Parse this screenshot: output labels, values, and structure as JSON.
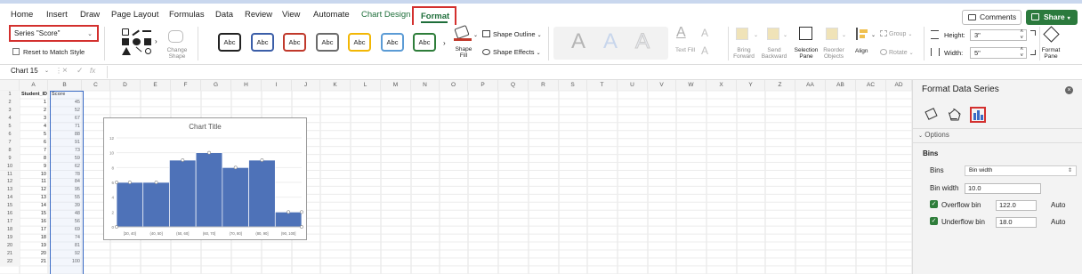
{
  "menu": {
    "tabs": [
      "Home",
      "Insert",
      "Draw",
      "Page Layout",
      "Formulas",
      "Data",
      "Review",
      "View",
      "Automate",
      "Chart Design"
    ],
    "active_tab": "Format",
    "comments": "Comments",
    "share": "Share"
  },
  "ribbon": {
    "series_select": "Series \"Score\"",
    "reset_label": "Reset to Match Style",
    "change_shape": [
      "Change",
      "Shape"
    ],
    "style_label": "Abc",
    "style_colors": [
      "#222222",
      "#3b5ea8",
      "#c0392b",
      "#6b6b6b",
      "#f2b705",
      "#5b9bd5",
      "#2e7d3a"
    ],
    "shape_fill": [
      "Shape",
      "Fill"
    ],
    "shape_outline": "Shape Outline",
    "shape_effects": "Shape Effects",
    "text_fill": "Text Fill",
    "bring_forward": [
      "Bring",
      "Forward"
    ],
    "send_backward": [
      "Send",
      "Backward"
    ],
    "selection_pane": [
      "Selection",
      "Pane"
    ],
    "reorder_objects": [
      "Reorder",
      "Objects"
    ],
    "align": "Align",
    "group": "Group",
    "rotate": "Rotate",
    "height_label": "Height:",
    "height_value": "3\"",
    "width_label": "Width:",
    "width_value": "5\"",
    "format_pane": [
      "Format",
      "Pane"
    ]
  },
  "formula_bar": {
    "name_box": "Chart 15",
    "fx": "fx"
  },
  "sheet": {
    "columns": [
      "A",
      "B",
      "C",
      "D",
      "E",
      "F",
      "G",
      "H",
      "I",
      "J",
      "K",
      "L",
      "M",
      "N",
      "O",
      "P",
      "Q",
      "R",
      "S",
      "T",
      "U",
      "V",
      "W",
      "X",
      "Y",
      "Z",
      "AA",
      "AB",
      "AC",
      "AD"
    ],
    "header_a": "Student_ID",
    "header_b": "Score",
    "rows": [
      [
        1,
        45
      ],
      [
        2,
        52
      ],
      [
        3,
        67
      ],
      [
        4,
        71
      ],
      [
        5,
        88
      ],
      [
        6,
        91
      ],
      [
        7,
        73
      ],
      [
        8,
        59
      ],
      [
        9,
        62
      ],
      [
        10,
        78
      ],
      [
        11,
        84
      ],
      [
        12,
        95
      ],
      [
        13,
        55
      ],
      [
        14,
        39
      ],
      [
        15,
        48
      ],
      [
        16,
        56
      ],
      [
        17,
        69
      ],
      [
        18,
        74
      ],
      [
        19,
        81
      ],
      [
        20,
        92
      ],
      [
        21,
        100
      ]
    ]
  },
  "chart": {
    "title": "Chart Title"
  },
  "chart_data": {
    "type": "bar",
    "title": "Chart Title",
    "categories": [
      "[30, 40]",
      "(40, 50]",
      "(50, 60]",
      "(60, 70]",
      "(70, 80]",
      "(80, 90]",
      "(90, 100]"
    ],
    "values": [
      6,
      6,
      9,
      10,
      8,
      9,
      2
    ],
    "ylim": [
      0,
      12
    ],
    "yticks": [
      0,
      2,
      4,
      6,
      8,
      10,
      12
    ],
    "xlabel": "",
    "ylabel": "",
    "color": "#4e72b8"
  },
  "panel": {
    "title": "Format Data Series",
    "section": "Options",
    "bins_heading": "Bins",
    "bins_label": "Bins",
    "bins_value": "Bin width",
    "bin_width_label": "Bin width",
    "bin_width_value": "10.0",
    "overflow_label": "Overflow bin",
    "overflow_value": "122.0",
    "underflow_label": "Underflow bin",
    "underflow_value": "18.0",
    "auto": "Auto"
  }
}
